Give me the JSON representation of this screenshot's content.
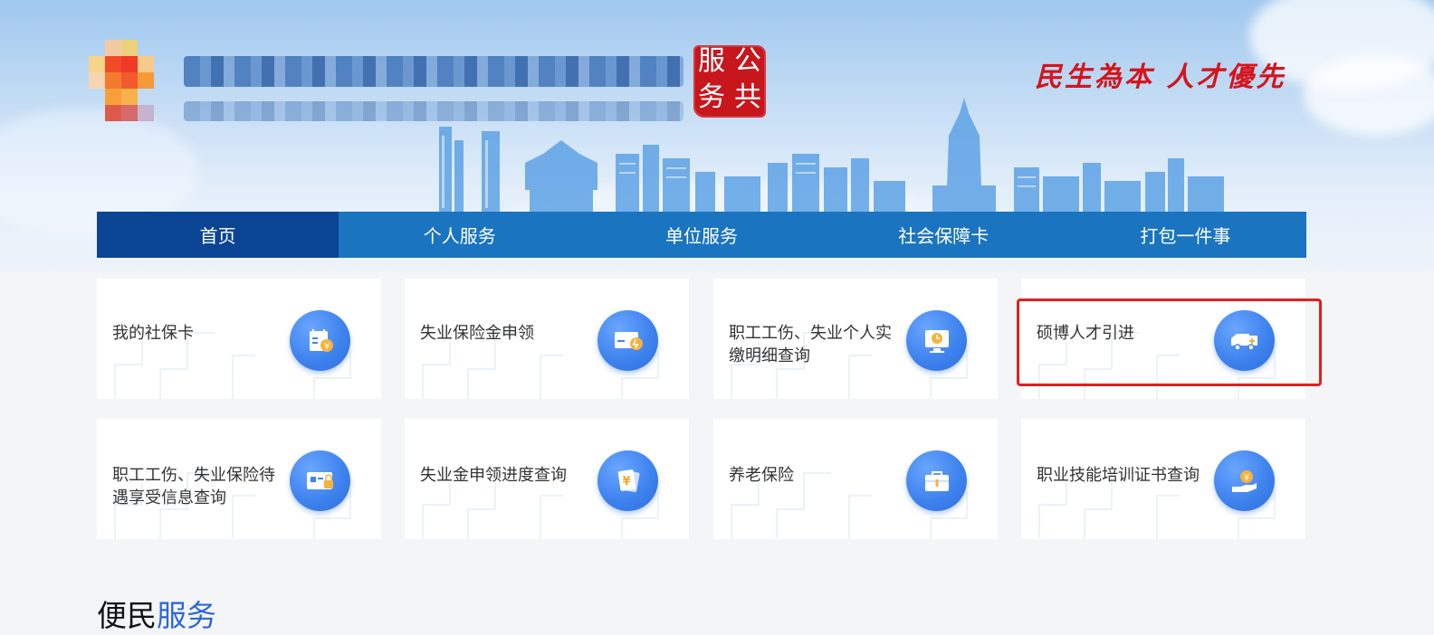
{
  "header": {
    "seal_chars": [
      "服",
      "公",
      "务",
      "共"
    ],
    "slogan": "民生為本 人才優先"
  },
  "nav": {
    "items": [
      {
        "label": "首页",
        "active": true
      },
      {
        "label": "个人服务",
        "active": false
      },
      {
        "label": "单位服务",
        "active": false
      },
      {
        "label": "社会保障卡",
        "active": false
      },
      {
        "label": "打包一件事",
        "active": false
      }
    ]
  },
  "services": [
    {
      "label": "我的社保卡",
      "icon": "social-card-icon"
    },
    {
      "label": "失业保险金申领",
      "icon": "benefit-card-icon"
    },
    {
      "label": "职工工伤、失业个人实缴明细查询",
      "icon": "monitor-clock-icon"
    },
    {
      "label": "硕博人才引进",
      "icon": "ambulance-icon"
    },
    {
      "label": "职工工伤、失业保险待遇享受信息查询",
      "icon": "id-lock-icon"
    },
    {
      "label": "失业金申领进度查询",
      "icon": "yuan-documents-icon"
    },
    {
      "label": "养老保险",
      "icon": "briefcase-icon"
    },
    {
      "label": "职业技能培训证书查询",
      "icon": "hand-yuan-icon"
    }
  ],
  "section": {
    "title_part1": "便民",
    "title_part2": "服务"
  },
  "colors": {
    "nav_bg": "#1a74c0",
    "nav_active": "#0a4593",
    "seal": "#c8161d",
    "highlight": "#e1201e",
    "accent": "#2f67d8"
  }
}
